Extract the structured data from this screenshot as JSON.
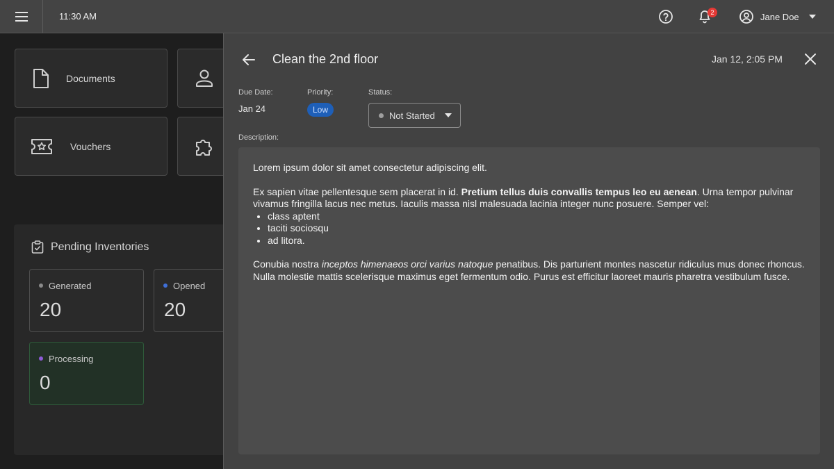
{
  "topbar": {
    "time": "11:30 AM",
    "notification_count": "2",
    "user_name": "Jane Doe"
  },
  "dashboard": {
    "cards": [
      {
        "label": "Documents",
        "icon": "document-icon"
      },
      {
        "label": "",
        "icon": "person-icon"
      },
      {
        "label": "Vouchers",
        "icon": "ticket-icon"
      },
      {
        "label": "",
        "icon": "puzzle-icon"
      }
    ],
    "inventories": {
      "title": "Pending Inventories",
      "icon": "clipboard-check-icon",
      "stats": [
        {
          "label": "Generated",
          "value": "20",
          "dot_color": "#8a8a8a"
        },
        {
          "label": "Opened",
          "value": "20",
          "dot_color": "#3f6fd8"
        },
        {
          "label": "Processing",
          "value": "0",
          "dot_color": "#8e5bd8"
        }
      ]
    }
  },
  "task": {
    "title": "Clean the 2nd floor",
    "timestamp": "Jan 12, 2:05 PM",
    "due_date_label": "Due Date:",
    "due_date": "Jan 24",
    "priority_label": "Priority:",
    "priority": "Low",
    "status_label": "Status:",
    "status": "Not Started",
    "description_label": "Description:",
    "description": {
      "p1": "Lorem ipsum dolor sit amet consectetur adipiscing elit.",
      "p2_start": "Ex sapien vitae pellentesque sem placerat in id. ",
      "p2_bold": "Pretium tellus duis convallis tempus leo eu aenean",
      "p2_end": ". Urna tempor pulvinar vivamus fringilla lacus nec metus. Iaculis massa nisl malesuada lacinia integer nunc posuere. Semper vel:",
      "list": [
        "class aptent",
        "taciti sociosqu",
        "ad litora."
      ],
      "p3_start": "Conubia nostra ",
      "p3_italic": "inceptos himenaeos orci varius natoque",
      "p3_end": " penatibus. Dis parturient montes nascetur ridiculus mus donec rhoncus. Nulla molestie mattis scelerisque maximus eget fermentum odio. Purus est efficitur laoreet mauris pharetra vestibulum fusce."
    }
  },
  "colors": {
    "accent_blue": "#1e5fb8",
    "processing_border": "#2e5a3a",
    "badge_red": "#e53935"
  }
}
